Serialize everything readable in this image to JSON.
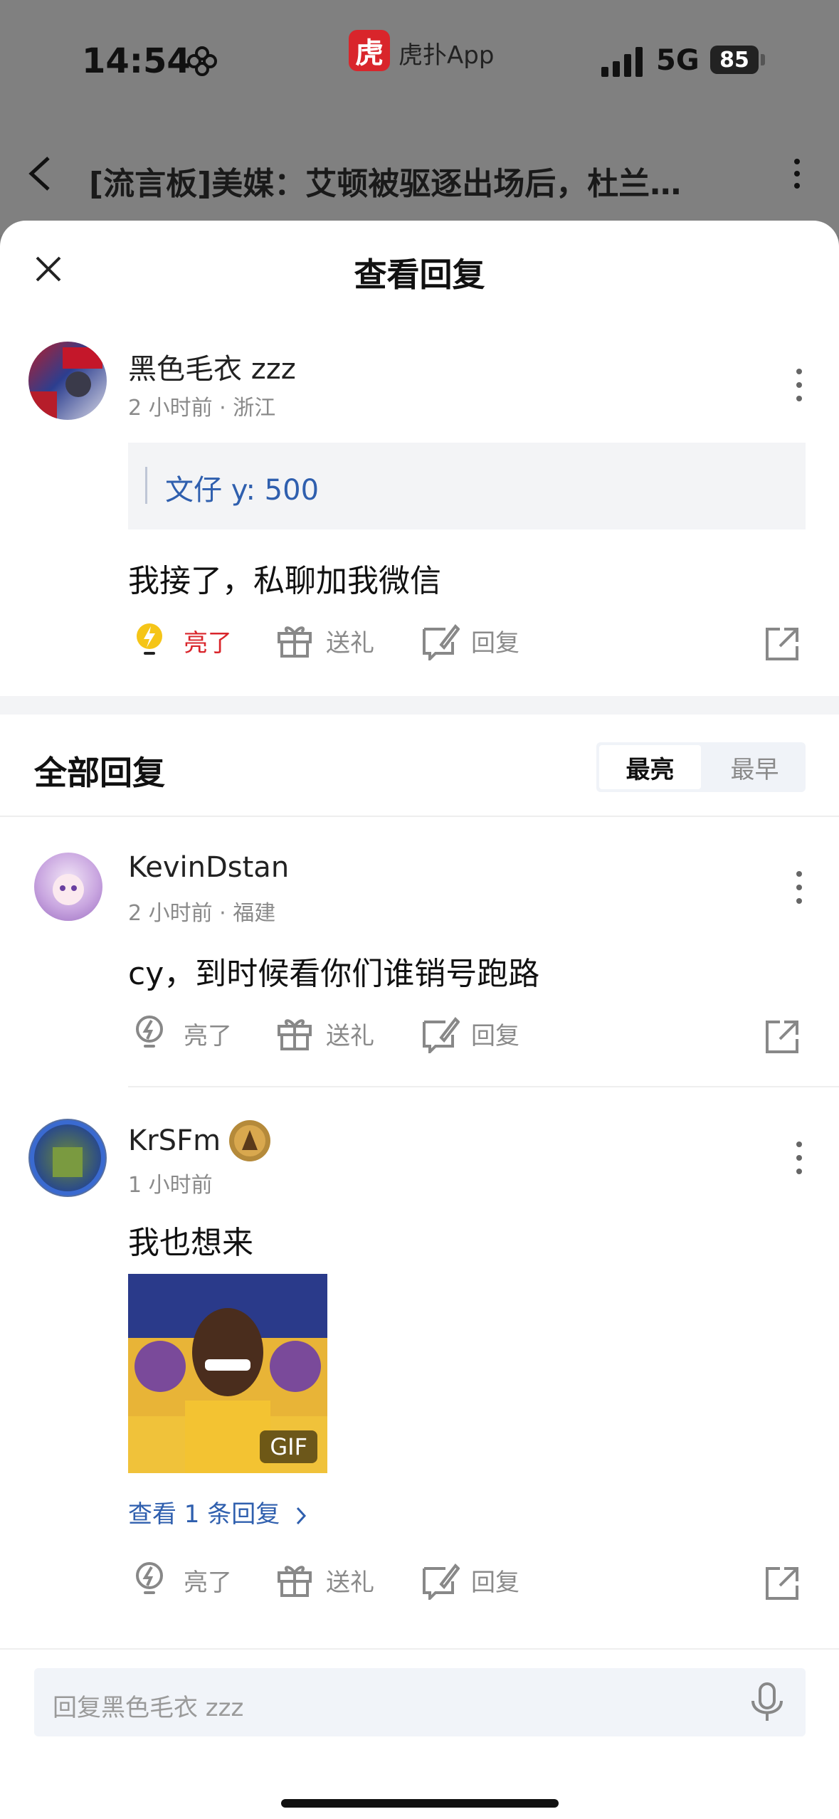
{
  "status_bar": {
    "time": "14:54",
    "app_name": "虎扑App",
    "app_badge": "虎",
    "network": "5G",
    "battery": "85"
  },
  "nav": {
    "title": "[流言板]美媒：艾顿被驱逐出场后，杜兰…"
  },
  "sheet": {
    "title": "查看回复"
  },
  "original_post": {
    "username": "黑色毛衣 zzz",
    "meta": "2 小时前 · 浙江",
    "quote": "文仔 y: 500",
    "body": "我接了，私聊加我微信",
    "actions": {
      "like": "亮了",
      "gift": "送礼",
      "reply": "回复"
    }
  },
  "replies_section": {
    "title": "全部回复",
    "sort_options": [
      "最亮",
      "最早"
    ],
    "selected_sort": "最亮"
  },
  "replies": [
    {
      "username": "KevinDstan",
      "meta": "2 小时前 · 福建",
      "body": "cy，到时候看你们谁销号跑路",
      "actions": {
        "like": "亮了",
        "gift": "送礼",
        "reply": "回复"
      }
    },
    {
      "username": "KrSFm",
      "meta": "1 小时前",
      "body": "我也想来",
      "gif_label": "GIF",
      "view_replies": "查看 1 条回复",
      "actions": {
        "like": "亮了",
        "gift": "送礼",
        "reply": "回复"
      }
    }
  ],
  "bottom_bar": {
    "placeholder": "回复黑色毛衣 zzz"
  },
  "colors": {
    "accent_red": "#d9252b",
    "link_blue": "#2f5fae",
    "muted": "#8a8a8a"
  },
  "icons": [
    "close-icon",
    "more-icon",
    "lightbulb-icon",
    "gift-icon",
    "reply-icon",
    "share-icon",
    "microphone-icon",
    "back-icon",
    "chevron-right-icon",
    "signal-icon"
  ]
}
